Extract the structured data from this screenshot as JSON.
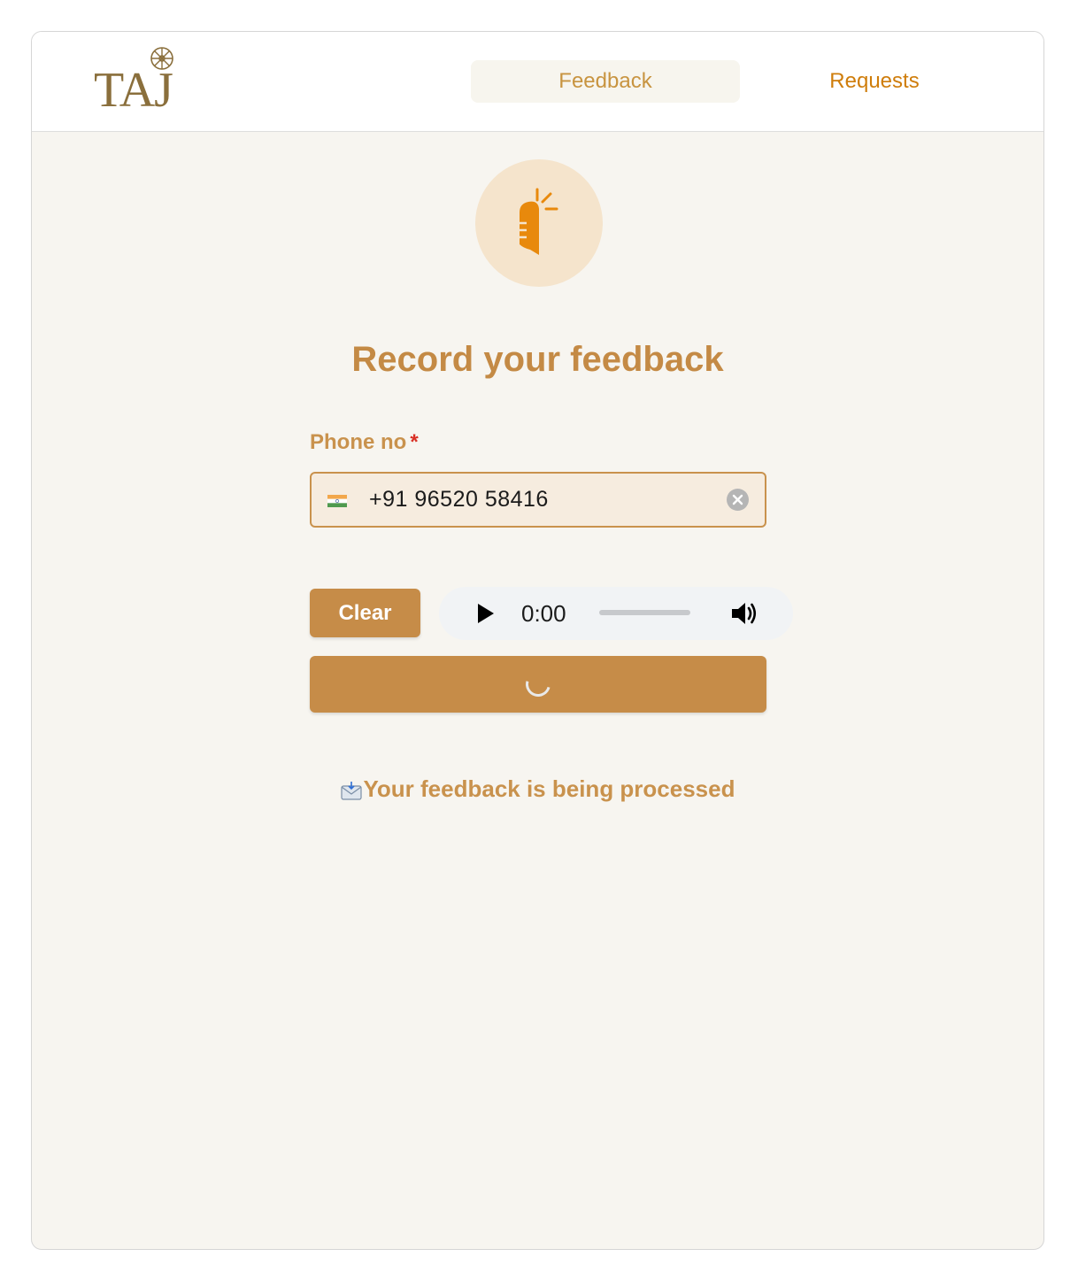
{
  "header": {
    "logo_text": "TAJ",
    "tabs": [
      {
        "label": "Feedback",
        "active": true
      },
      {
        "label": "Requests",
        "active": false
      }
    ]
  },
  "main": {
    "hero_icon": "hand-raise-icon",
    "title": "Record your feedback",
    "phone": {
      "label": "Phone no",
      "required_mark": "*",
      "country_flag": "india-flag-icon",
      "value": "+91 96520 58416"
    },
    "clear_label": "Clear",
    "audio": {
      "time": "0:00"
    },
    "submit_state": "loading",
    "status_icon": "incoming-envelope-icon",
    "status_text": "Your feedback is being processed"
  },
  "colors": {
    "accent": "#c68c48",
    "tab_active_text": "#c89440",
    "tab_text": "#cf7d0b",
    "background": "#f7f5f0",
    "icon_orange": "#e8890c"
  }
}
